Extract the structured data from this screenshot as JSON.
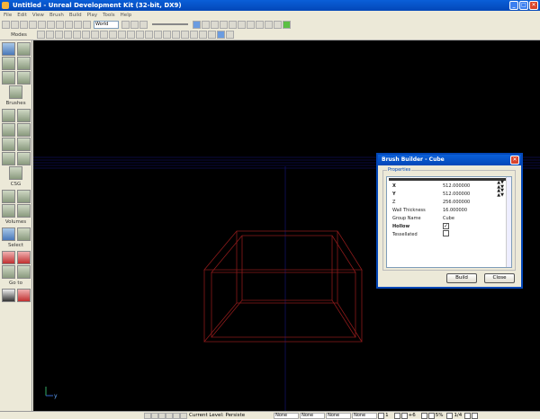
{
  "window": {
    "title": "Untitled - Unreal Development Kit (32-bit, DX9)"
  },
  "menu": [
    "File",
    "Edit",
    "View",
    "Brush",
    "Build",
    "Play",
    "Tools",
    "Help"
  ],
  "toolbar": {
    "coord_system": "World"
  },
  "left_panel": {
    "modes_label": "Modes",
    "brushes_label": "Brushes",
    "csg_label": "CSG",
    "volumes_label": "Volumes",
    "select_label": "Select",
    "goto_label": "Go to"
  },
  "dialog": {
    "title": "Brush Builder - Cube",
    "properties_label": "Properties",
    "properties": [
      {
        "name": "X",
        "value": "512.000000",
        "bold": true
      },
      {
        "name": "Y",
        "value": "512.000000",
        "bold": true
      },
      {
        "name": "Z",
        "value": "256.000000",
        "bold": false
      },
      {
        "name": "Wall Thickness",
        "value": "16.000000",
        "bold": false
      },
      {
        "name": "Group Name",
        "value": "Cube",
        "bold": false
      },
      {
        "name": "Hollow",
        "value": "",
        "checked": true,
        "bold": true
      },
      {
        "name": "Tessellated",
        "value": "",
        "checked": false,
        "bold": false
      }
    ],
    "build_label": "Build",
    "close_label": "Close"
  },
  "viewport": {
    "axis_y_label": "y"
  },
  "statusbar": {
    "current_level_label": "Current Level:  Persiste",
    "cells": [
      "None",
      "None",
      "None",
      "None"
    ],
    "grid_value": "1",
    "snap_value": "+6",
    "percent": "5%",
    "zoom": "1/4"
  },
  "colors": {
    "titlebar": "#0347b8",
    "brush_wire": "#8b1a1a",
    "grid_line": "#1a1aa0"
  }
}
